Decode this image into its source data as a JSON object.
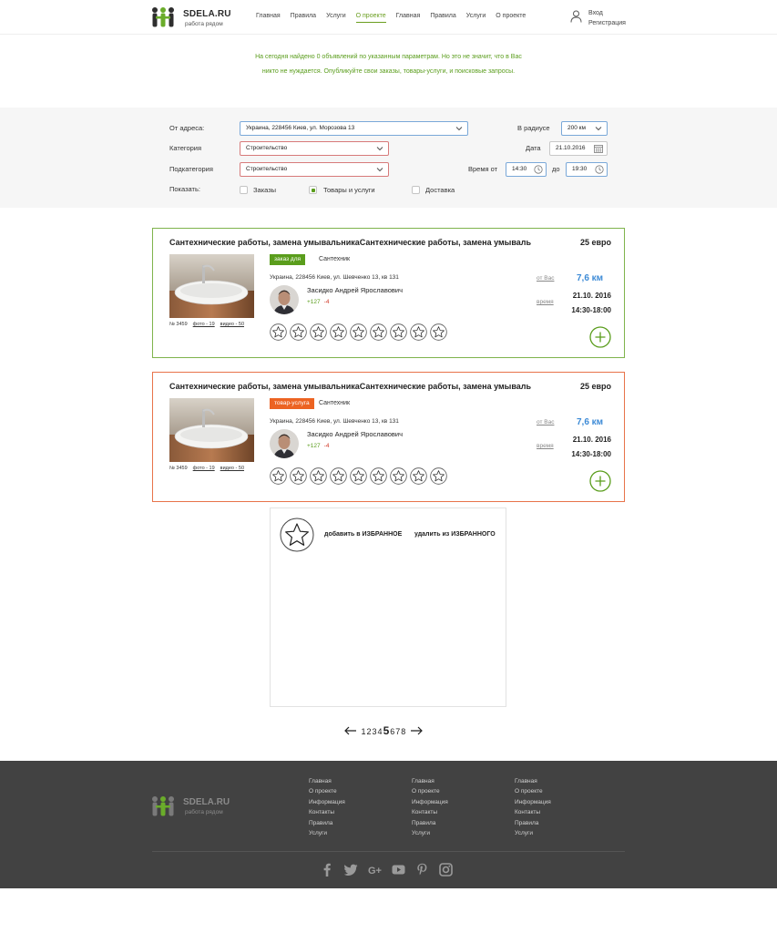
{
  "header": {
    "logo_title": "SDELA.RU",
    "logo_subtitle": "работа рядом",
    "nav": [
      "Главная",
      "Правила",
      "Услуги",
      "О проекте",
      "Главная",
      "Правила",
      "Услуги",
      "О проекте"
    ],
    "nav_active_index": 3,
    "login": "Вход",
    "register": "Регистрация"
  },
  "notice": "На сегодня найдено 0 объявлений по указанным параметрам. Но это не значит, что в Вас никто не нуждается. Опубликуйте свои заказы, товары-услуги, и поисковые запросы.",
  "filter": {
    "address_label": "От адреса:",
    "address_value": "Украина, 228456 Киев, ул. Морозова 13",
    "radius_label": "В радиусе",
    "radius_value": "200 км",
    "category_label": "Категория",
    "category_value": "Строительство",
    "date_label": "Дата",
    "date_value": "21.10.2016",
    "subcategory_label": "Подкатегория",
    "subcategory_value": "Строительство",
    "time_from_label": "Время от",
    "time_from_value": "14:30",
    "time_to_label": "до",
    "time_to_value": "19:30",
    "show_label": "Показать:",
    "checkboxes": [
      {
        "label": "Заказы",
        "checked": false
      },
      {
        "label": "Товары и услуги",
        "checked": true
      },
      {
        "label": "Доставка",
        "checked": false
      }
    ]
  },
  "cards": [
    {
      "title": "Сантехнические работы, замена умывальникаСантехнические работы, замена умываль",
      "price": "25  евро",
      "badge": "заказ для",
      "badge_color": "#5a9d1c",
      "category": "Сантехник",
      "address": "Украина, 228456 Киев, ул. Шевченко 13, кв 131",
      "name": "Засидко Андрей Ярославович",
      "rating_plus": "+127",
      "rating_minus": "-4",
      "number": "№ 3459",
      "photo": "фото - 19",
      "video": "видео - 50",
      "dist_label": "от Вас",
      "dist": "7,6 км",
      "time_label": "время",
      "date": "21.10. 2016",
      "hours": "14:30-18:00"
    },
    {
      "title": "Сантехнические работы, замена умывальникаСантехнические работы, замена умываль",
      "price": "25  евро",
      "badge": "товар-услуга",
      "badge_color": "#ec6322",
      "category": "Сантехник",
      "address": "Украина, 228456 Киев, ул. Шевченко 13, кв 131",
      "name": "Засидко Андрей Ярославович",
      "rating_plus": "+127",
      "rating_minus": "-4",
      "number": "№ 3459",
      "photo": "фото - 19",
      "video": "видео - 50",
      "dist_label": "от Вас",
      "dist": "7,6 км",
      "time_label": "время",
      "date": "21.10. 2016",
      "hours": "14:30-18:00"
    }
  ],
  "popup": {
    "add": "добавить в ИЗБРАННОЕ",
    "remove": "удалить из ИЗБРАННОГО"
  },
  "pagination": {
    "pages": [
      "1",
      "2",
      "3",
      "4",
      "5",
      "6",
      "7",
      "8"
    ],
    "current": "5"
  },
  "footer": {
    "logo_title": "SDELA.RU",
    "logo_subtitle": "работа рядом",
    "columns": [
      [
        "Главная",
        "О проекте",
        "Информация",
        "Контакты",
        "Правила",
        "Услуги"
      ],
      [
        "Главная",
        "О проекте",
        "Информация",
        "Контакты",
        "Правила",
        "Услуги"
      ],
      [
        "Главная",
        "О проекте",
        "Информация",
        "Контакты",
        "Правила",
        "Услуги"
      ]
    ],
    "social": [
      "facebook-icon",
      "twitter-icon",
      "google-plus-icon",
      "youtube-icon",
      "pinterest-icon",
      "instagram-icon"
    ]
  },
  "colors": {
    "accent_green": "#5a9d1c",
    "accent_orange": "#ec6322",
    "distance_blue": "#3c8ad6",
    "footer_bg": "#424242"
  }
}
